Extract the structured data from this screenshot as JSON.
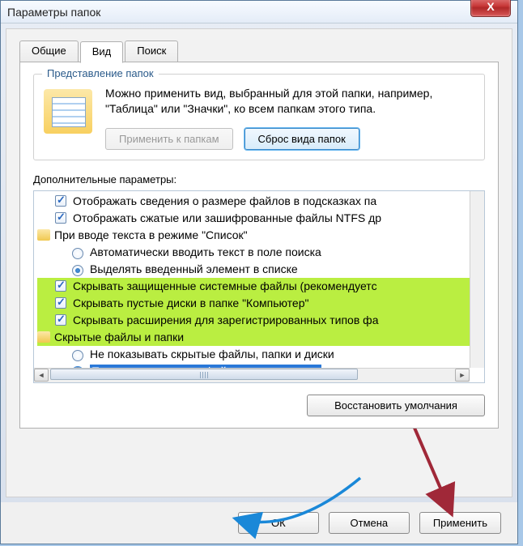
{
  "window": {
    "title": "Параметры папок",
    "close_label": "X"
  },
  "tabs": {
    "general": "Общие",
    "view": "Вид",
    "search": "Поиск"
  },
  "group": {
    "title": "Представление папок",
    "description": "Можно применить вид, выбранный для этой папки, например, \"Таблица\" или \"Значки\", ко всем папкам этого типа.",
    "apply_btn": "Применить к папкам",
    "reset_btn": "Сброс вида папок"
  },
  "advanced": {
    "label": "Дополнительные параметры:",
    "items": [
      {
        "type": "checkbox",
        "checked": true,
        "indent": 1,
        "label": "Отображать сведения о размере файлов в подсказках па"
      },
      {
        "type": "checkbox",
        "checked": true,
        "indent": 1,
        "label": "Отображать сжатые или зашифрованные файлы NTFS др"
      },
      {
        "type": "folder",
        "indent": 0,
        "label": "При вводе текста в режиме \"Список\""
      },
      {
        "type": "radio",
        "checked": false,
        "group": "list",
        "indent": 2,
        "label": "Автоматически вводить текст в поле поиска"
      },
      {
        "type": "radio",
        "checked": true,
        "group": "list",
        "indent": 2,
        "label": "Выделять введенный элемент в списке"
      },
      {
        "type": "checkbox",
        "checked": true,
        "indent": 1,
        "hl": true,
        "label": "Скрывать защищенные системные файлы (рекомендуетс"
      },
      {
        "type": "checkbox",
        "checked": true,
        "indent": 1,
        "hl": true,
        "label": "Скрывать пустые диски в папке \"Компьютер\""
      },
      {
        "type": "checkbox",
        "checked": true,
        "indent": 1,
        "hl": true,
        "label": "Скрывать расширения для зарегистрированных типов фа"
      },
      {
        "type": "folder",
        "indent": 0,
        "hl": true,
        "label": "Скрытые файлы и папки"
      },
      {
        "type": "radio",
        "checked": false,
        "group": "hidden",
        "indent": 2,
        "label": "Не показывать скрытые файлы, папки и диски"
      },
      {
        "type": "radio",
        "checked": true,
        "group": "hidden",
        "indent": 2,
        "selected": true,
        "label": "Показывать скрытые файлы, папки и диски"
      }
    ],
    "restore_btn": "Восстановить умолчания"
  },
  "buttons": {
    "ok": "ОК",
    "cancel": "Отмена",
    "apply": "Применить"
  }
}
